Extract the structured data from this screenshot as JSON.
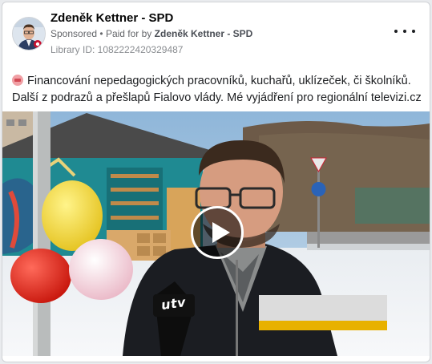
{
  "post": {
    "page_name": "Zdeněk Kettner - SPD",
    "sponsored_label": "Sponsored",
    "separator": "•",
    "paid_for_prefix": "Paid for by",
    "paid_for_by": "Zdeněk Kettner - SPD",
    "library_id": "Library ID: 1082222420329487",
    "text": "Financování nepedagogických pracovníků, kuchařů, uklízeček, či školníků. Další z podrazů a přešlapů Fialovo vlády. Mé vyjádření pro regionální televizi.cz",
    "emoji_icon": "ticket-emoji-icon"
  },
  "video": {
    "microphone_logo": "utv",
    "lower_third_accent": "#e8b100",
    "play_icon": "play-icon"
  }
}
